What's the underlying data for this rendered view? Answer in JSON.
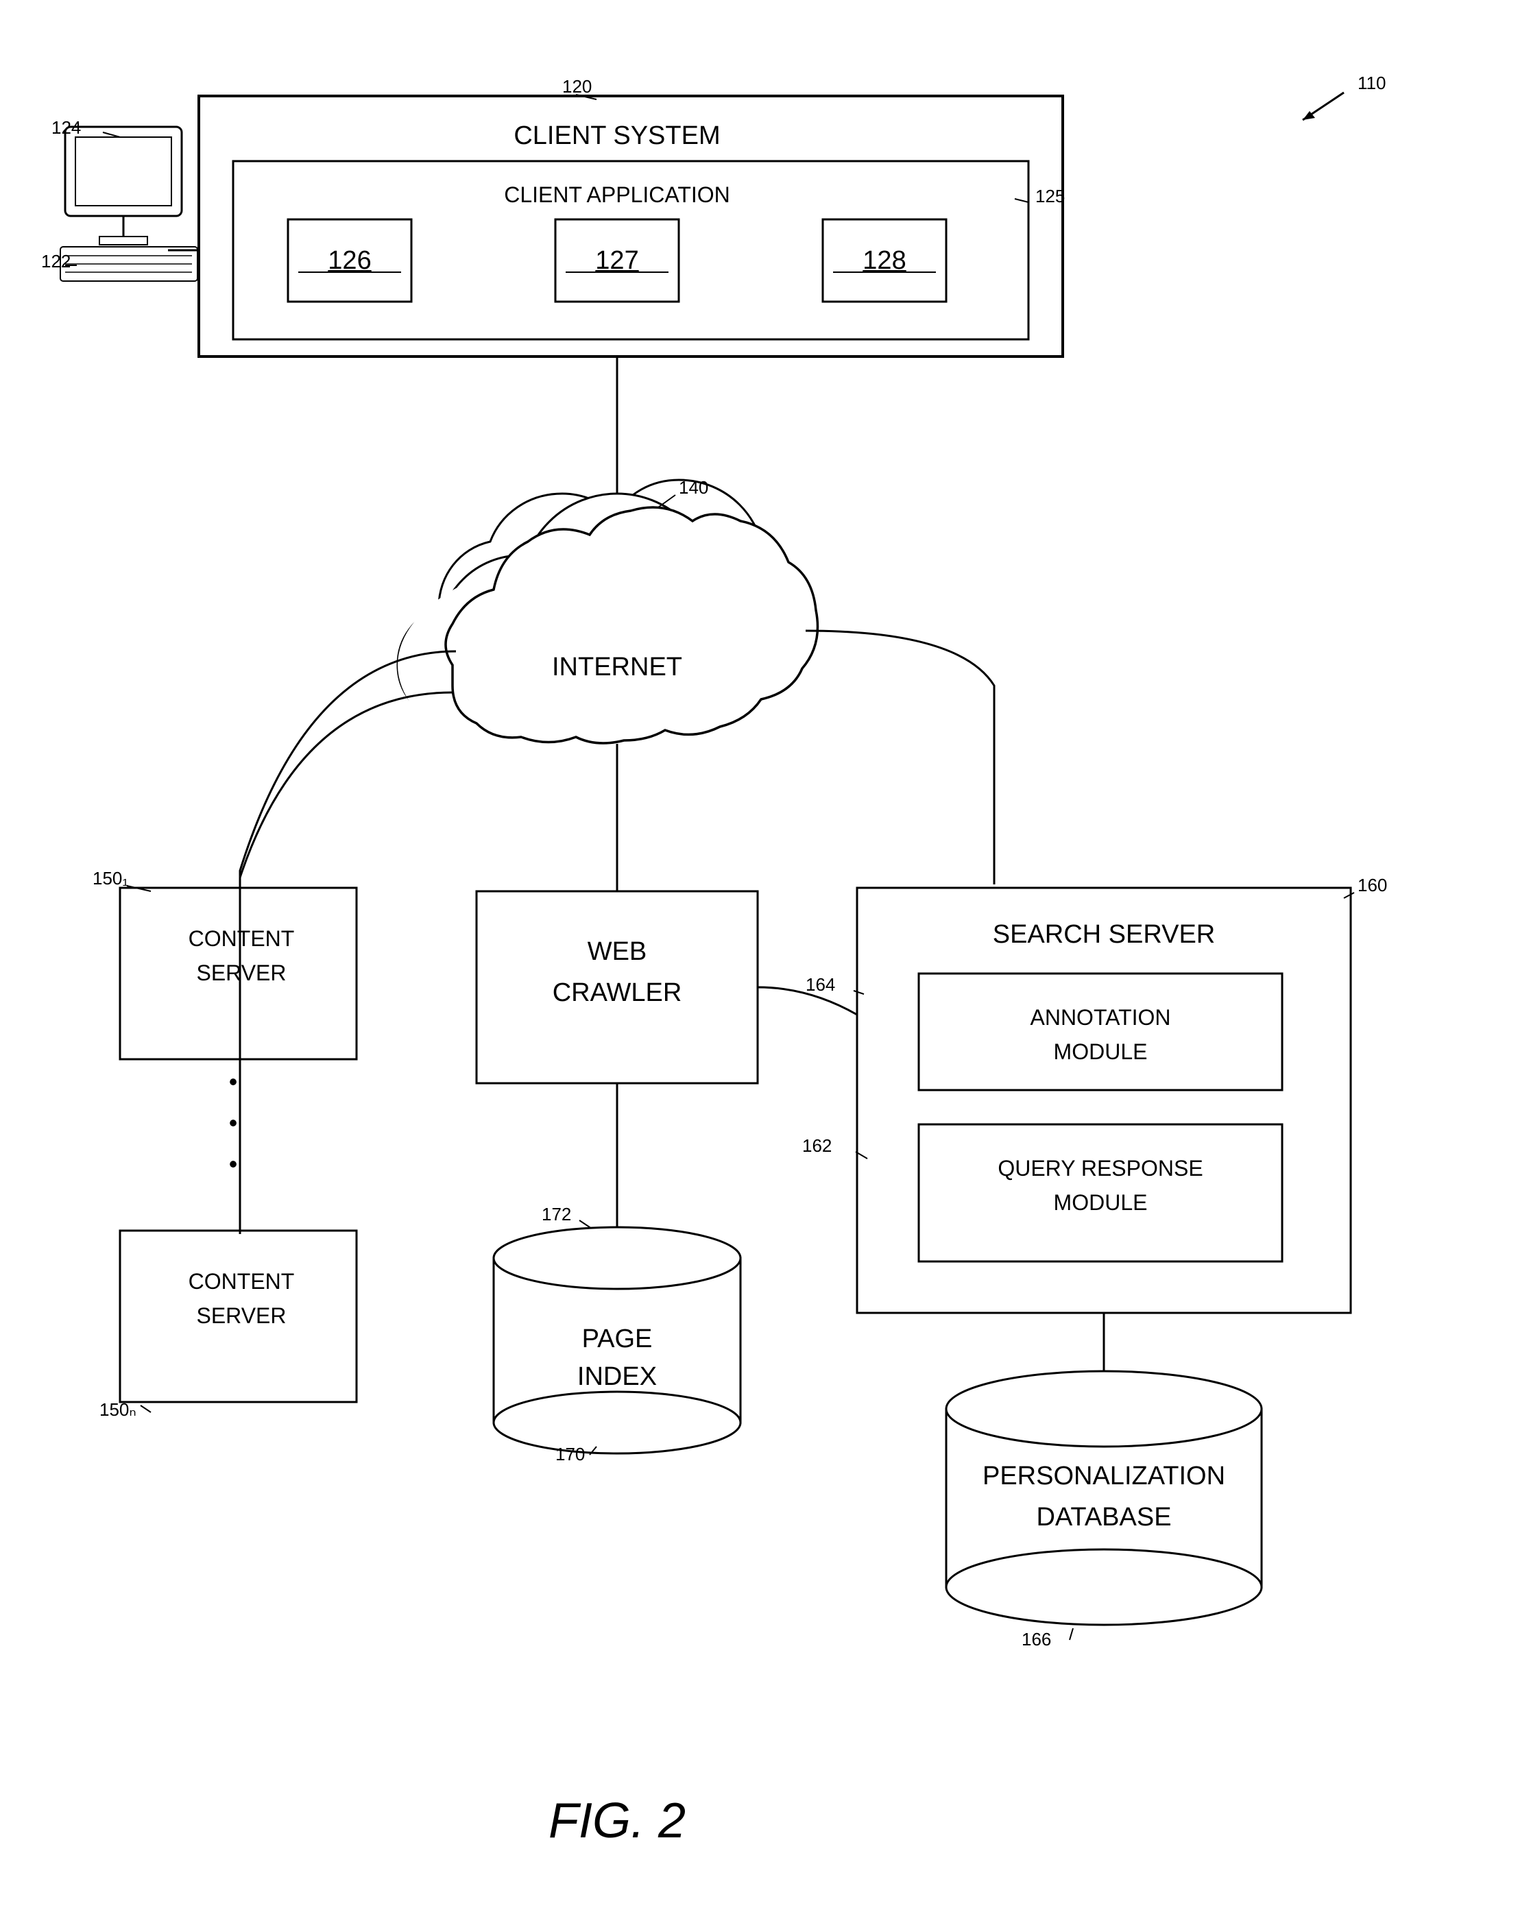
{
  "diagram": {
    "title": "FIG. 2",
    "ref_main": "110",
    "client_system": {
      "label": "CLIENT SYSTEM",
      "ref": "120",
      "client_application": {
        "label": "CLIENT APPLICATION",
        "ref": "125",
        "modules": [
          {
            "ref": "126"
          },
          {
            "ref": "127"
          },
          {
            "ref": "128"
          }
        ]
      }
    },
    "computer": {
      "ref_top": "124",
      "ref_bottom": "122"
    },
    "internet": {
      "label": "INTERNET",
      "ref": "140"
    },
    "content_servers": [
      {
        "label": "CONTENT\nSERVER",
        "ref": "150₁"
      },
      {
        "label": "CONTENT\nSERVER",
        "ref": "150ₙ"
      }
    ],
    "web_crawler": {
      "label": "WEB\nCRAWLER",
      "ref": "no-ref"
    },
    "page_index": {
      "label": "PAGE\nINDEX",
      "ref": "170",
      "ref2": "172"
    },
    "search_server": {
      "label": "SEARCH SERVER",
      "ref": "160",
      "annotation_module": {
        "label": "ANNOTATION\nMODULE",
        "ref": "164"
      },
      "query_response_module": {
        "label": "QUERY RESPONSE\nMODULE",
        "ref": "162"
      }
    },
    "personalization_database": {
      "label": "PERSONALIZATION\nDATABASE",
      "ref": "166"
    }
  }
}
